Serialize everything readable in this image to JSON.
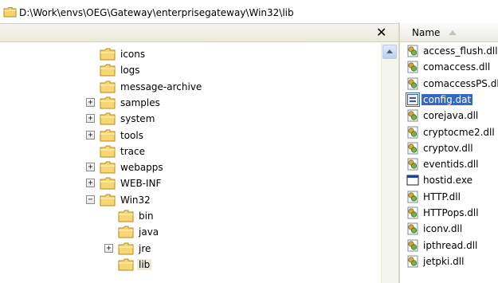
{
  "address": {
    "path": "D:\\Work\\envs\\OEG\\Gateway\\enterprisegateway\\Win32\\lib",
    "icon": "folder-icon"
  },
  "tree_pane": {
    "close_glyph": "✕"
  },
  "tree": [
    {
      "label": "icons",
      "expander": "",
      "level": 0,
      "selected": false
    },
    {
      "label": "logs",
      "expander": "",
      "level": 0,
      "selected": false
    },
    {
      "label": "message-archive",
      "expander": "",
      "level": 0,
      "selected": false
    },
    {
      "label": "samples",
      "expander": "+",
      "level": 0,
      "selected": false
    },
    {
      "label": "system",
      "expander": "+",
      "level": 0,
      "selected": false
    },
    {
      "label": "tools",
      "expander": "+",
      "level": 0,
      "selected": false
    },
    {
      "label": "trace",
      "expander": "",
      "level": 0,
      "selected": false
    },
    {
      "label": "webapps",
      "expander": "+",
      "level": 0,
      "selected": false
    },
    {
      "label": "WEB-INF",
      "expander": "+",
      "level": 0,
      "selected": false
    },
    {
      "label": "Win32",
      "expander": "−",
      "level": 0,
      "selected": false
    },
    {
      "label": "bin",
      "expander": "",
      "level": 1,
      "selected": false
    },
    {
      "label": "java",
      "expander": "",
      "level": 1,
      "selected": false
    },
    {
      "label": "jre",
      "expander": "+",
      "level": 1,
      "selected": false
    },
    {
      "label": "lib",
      "expander": "",
      "level": 1,
      "selected": true
    }
  ],
  "file_list": {
    "column_header": "Name",
    "files": [
      {
        "name": "access_flush.dll",
        "icon": "dll-icon",
        "selected": false
      },
      {
        "name": "comaccess.dll",
        "icon": "dll-icon",
        "selected": false
      },
      {
        "name": "comaccessPS.dll",
        "icon": "dll-icon",
        "selected": false
      },
      {
        "name": "config.dat",
        "icon": "dat-file-icon",
        "selected": true
      },
      {
        "name": "corejava.dll",
        "icon": "dll-icon",
        "selected": false
      },
      {
        "name": "cryptocme2.dll",
        "icon": "dll-icon",
        "selected": false
      },
      {
        "name": "cryptov.dll",
        "icon": "dll-icon",
        "selected": false
      },
      {
        "name": "eventids.dll",
        "icon": "dll-icon",
        "selected": false
      },
      {
        "name": "hostid.exe",
        "icon": "exe-icon",
        "selected": false
      },
      {
        "name": "HTTP.dll",
        "icon": "dll-icon",
        "selected": false
      },
      {
        "name": "HTTPops.dll",
        "icon": "dll-icon",
        "selected": false
      },
      {
        "name": "iconv.dll",
        "icon": "dll-icon",
        "selected": false
      },
      {
        "name": "ipthread.dll",
        "icon": "dll-icon",
        "selected": false
      },
      {
        "name": "jetpki.dll",
        "icon": "dll-icon",
        "selected": false
      }
    ]
  },
  "colors": {
    "selection": "#316ac5",
    "folder": "#f5d36b",
    "header": "#ebeadb"
  }
}
